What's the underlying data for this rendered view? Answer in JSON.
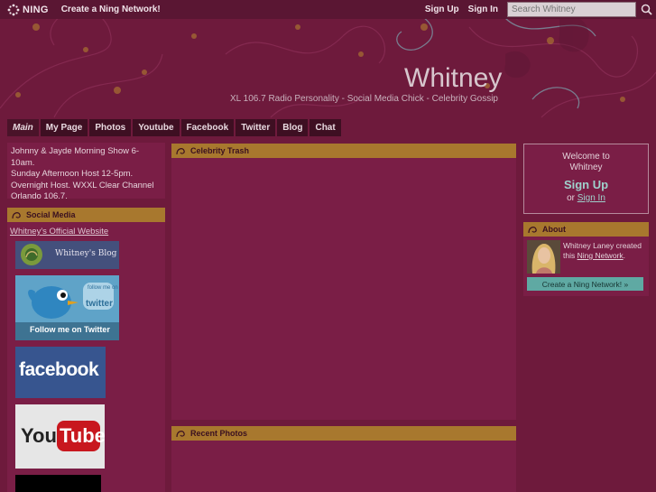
{
  "ningbar": {
    "logo": "NING",
    "create_link": "Create a Ning Network!",
    "sign_up": "Sign Up",
    "sign_in": "Sign In",
    "search_placeholder": "Search Whitney"
  },
  "header": {
    "title": "Whitney",
    "tagline": "XL 106.7 Radio Personality - Social Media Chick - Celebrity Gossip"
  },
  "tabs": [
    {
      "label": "Main"
    },
    {
      "label": "My Page"
    },
    {
      "label": "Photos"
    },
    {
      "label": "Youtube"
    },
    {
      "label": "Facebook"
    },
    {
      "label": "Twitter"
    },
    {
      "label": "Blog"
    },
    {
      "label": "Chat"
    }
  ],
  "bio": {
    "line1": "Johnny & Jayde Morning Show 6-10am.",
    "line2": "Sunday Afternoon Host 12-5pm.",
    "line3": "Overnight Host. WXXL Clear Channel",
    "line4": "Orlando 106.7."
  },
  "social": {
    "heading": "Social Media",
    "official_link": "Whitney's Official Website",
    "blog_badge": "Whitney's Blog",
    "twitter_badge": "Follow me on Twitter",
    "twitter_word": "twitter",
    "twitter_follow": "follow me on",
    "facebook_badge": "facebook",
    "youtube_badge_you": "You",
    "youtube_badge_tube": "Tube"
  },
  "center": {
    "celebrity_heading": "Celebrity Trash",
    "photos_heading": "Recent Photos"
  },
  "welcome": {
    "welcome_to": "Welcome to",
    "name": "Whitney",
    "sign_up": "Sign Up",
    "or": "or",
    "sign_in": "Sign In"
  },
  "about": {
    "heading": "About",
    "name_text": "Whitney Laney",
    "created_text": "created this",
    "network_link": "Ning Network",
    "create_button": "Create a Ning Network! »"
  },
  "colors": {
    "background": "#6e1a3c",
    "module_header": "#a8782e",
    "accent": "#5fa9a3"
  }
}
